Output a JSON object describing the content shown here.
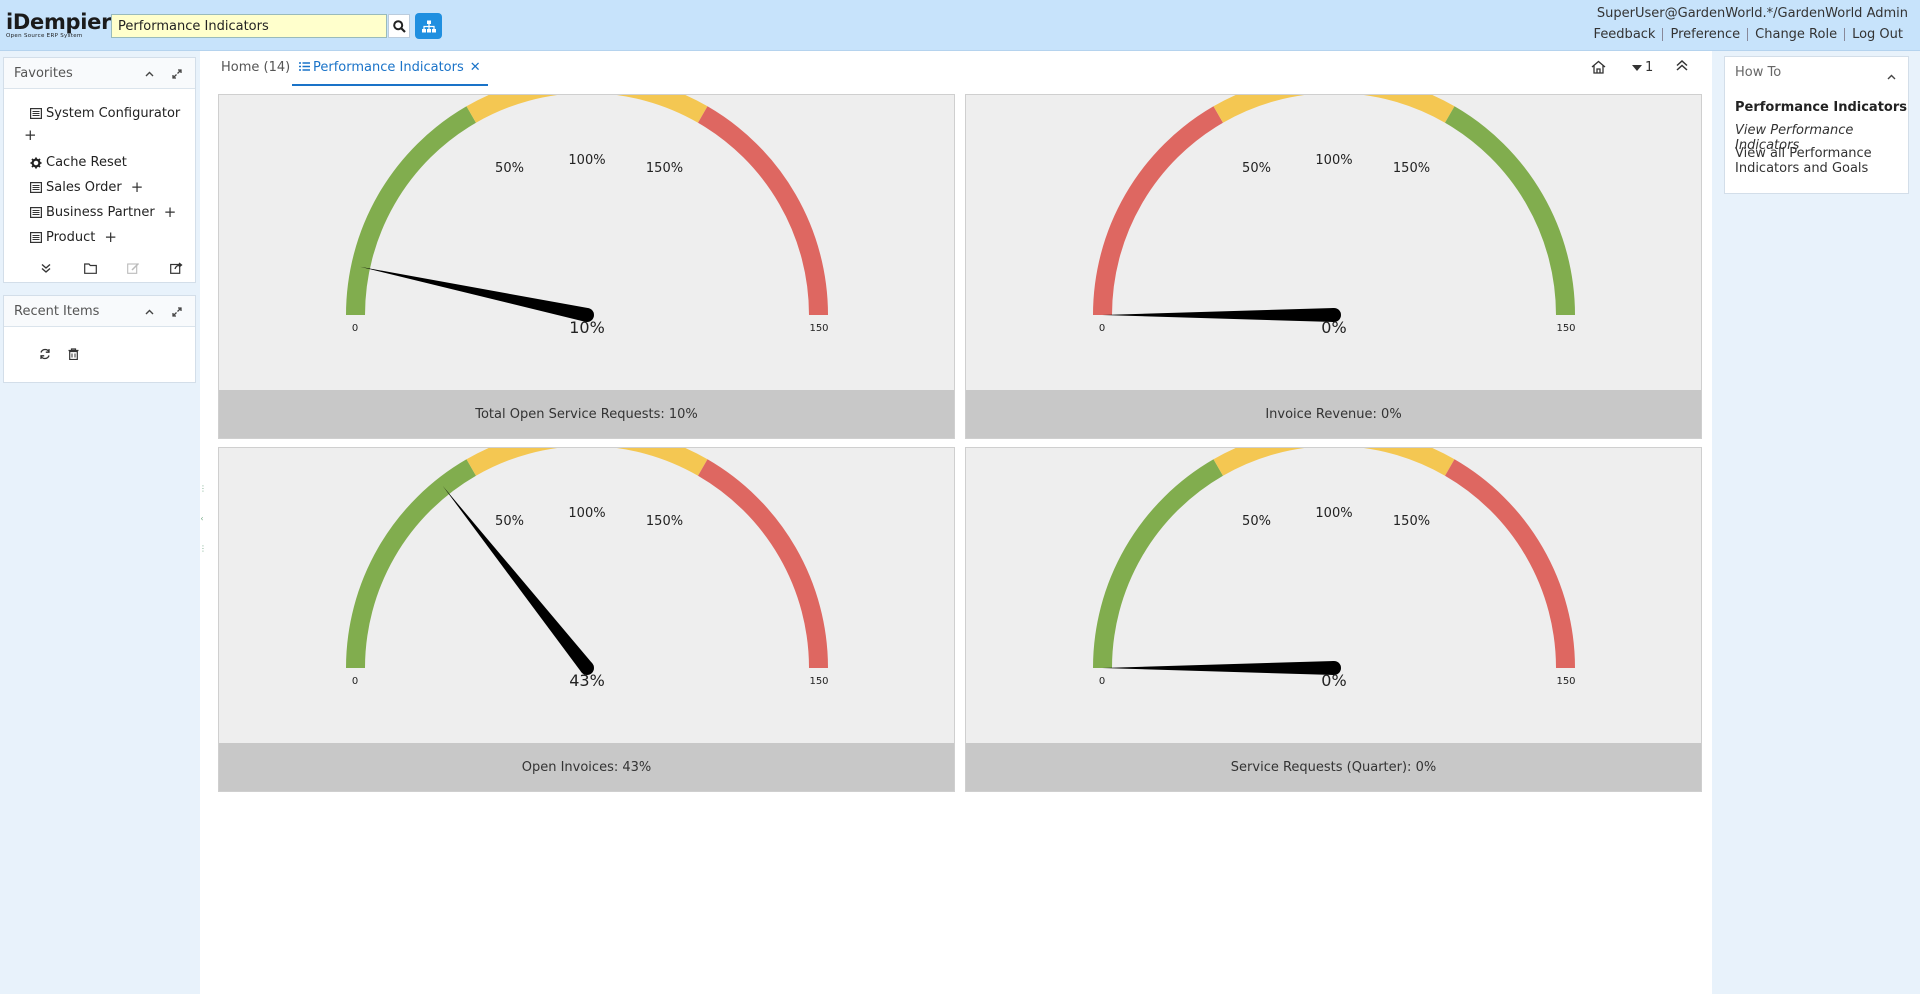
{
  "app": {
    "logo": "iDempiere",
    "logo_sub": "Open Source ERP System",
    "search_value": "Performance Indicators",
    "user": "SuperUser@GardenWorld.*/GardenWorld Admin",
    "links": [
      "Feedback",
      "Preference",
      "Change Role",
      "Log Out"
    ]
  },
  "favorites": {
    "title": "Favorites",
    "items": [
      {
        "label": "System Configurator",
        "icon": "window-icon"
      },
      {
        "label": "Cache Reset",
        "icon": "gear-icon"
      },
      {
        "label": "Sales Order",
        "icon": "window-icon"
      },
      {
        "label": "Business Partner",
        "icon": "window-icon"
      },
      {
        "label": "Product",
        "icon": "window-icon"
      }
    ]
  },
  "recent": {
    "title": "Recent Items"
  },
  "tabs": [
    {
      "label": "Home (14)",
      "active": false
    },
    {
      "label": "Performance Indicators",
      "active": true
    }
  ],
  "tab_controls": {
    "count": "1"
  },
  "gauges": [
    {
      "label": "Total Open Service Requests: 10%",
      "value": 10,
      "value_text": "10%",
      "mirrored": false
    },
    {
      "label": "Invoice Revenue: 0%",
      "value": 0,
      "value_text": "0%",
      "mirrored": true
    },
    {
      "label": "Open Invoices: 43%",
      "value": 43,
      "value_text": "43%",
      "mirrored": false
    },
    {
      "label": "Service Requests (Quarter): 0%",
      "value": 0,
      "value_text": "0%",
      "mirrored": false
    }
  ],
  "gauge_ticks": {
    "min": "0",
    "max": "150",
    "p50": "50%",
    "p100": "100%",
    "p150": "150%"
  },
  "colors": {
    "green": "#81ad4e",
    "yellow": "#f4c752",
    "red": "#de6761"
  },
  "howto": {
    "title": "How To",
    "heading": "Performance Indicators",
    "link": "View Performance Indicators",
    "description": "View all Performance Indicators and Goals"
  }
}
